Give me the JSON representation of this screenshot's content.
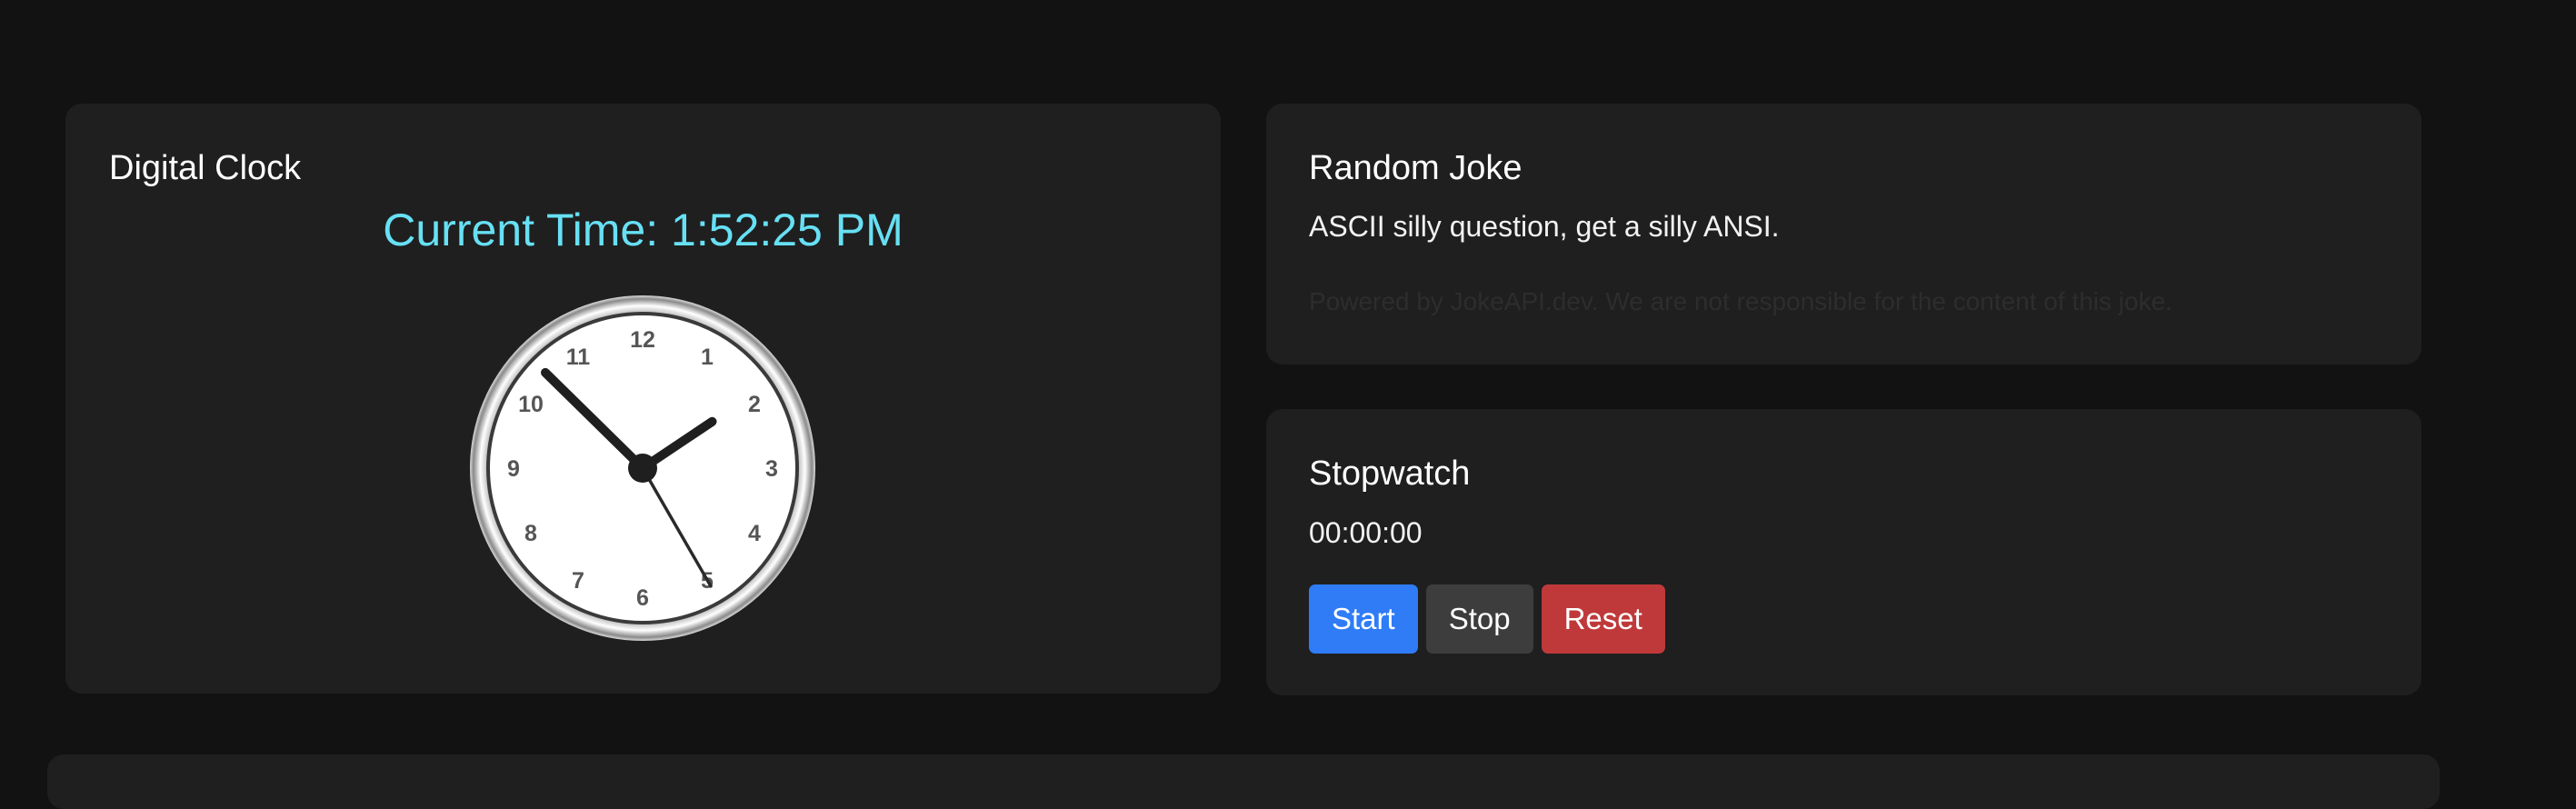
{
  "digital_clock": {
    "title": "Digital Clock",
    "time_text": "Current Time: 1:52:25 PM",
    "analog": {
      "hours": 13,
      "minutes": 52,
      "seconds": 25,
      "numerals": [
        "12",
        "1",
        "2",
        "3",
        "4",
        "5",
        "6",
        "7",
        "8",
        "9",
        "10",
        "11"
      ]
    }
  },
  "joke": {
    "title": "Random Joke",
    "text": "ASCII silly question, get a silly ANSI.",
    "credit": "Powered by JokeAPI.dev. We are not responsible for the content of this joke."
  },
  "stopwatch": {
    "title": "Stopwatch",
    "display": "00:00:00",
    "start_label": "Start",
    "stop_label": "Stop",
    "reset_label": "Reset"
  },
  "colors": {
    "background": "#121212",
    "card": "#1f1f1f",
    "time_accent": "#67e0f4",
    "start_button": "#2f7cf6",
    "stop_button": "#3d3d3d",
    "reset_button": "#c0393a"
  }
}
